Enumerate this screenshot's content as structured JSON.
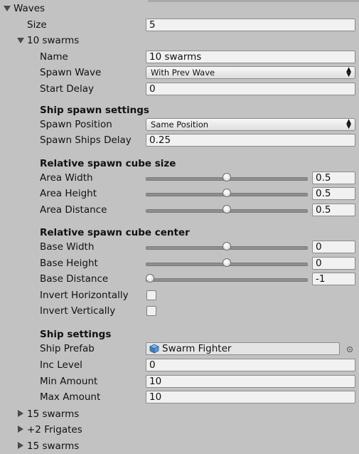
{
  "waves": {
    "label": "Waves",
    "size": {
      "label": "Size",
      "value": "5"
    },
    "element": {
      "label": "10 swarms",
      "name": {
        "label": "Name",
        "value": "10 swarms"
      },
      "spawn_wave": {
        "label": "Spawn Wave",
        "value": "With Prev Wave"
      },
      "start_delay": {
        "label": "Start Delay",
        "value": "0"
      }
    },
    "ship_spawn_settings": {
      "header": "Ship spawn settings",
      "spawn_position": {
        "label": "Spawn Position",
        "value": "Same Position"
      },
      "spawn_ships_delay": {
        "label": "Spawn Ships Delay",
        "value": "0.25"
      }
    },
    "cube_size": {
      "header": "Relative spawn cube size",
      "area_width": {
        "label": "Area Width",
        "value": "0.5",
        "level": 0.5
      },
      "area_height": {
        "label": "Area Height",
        "value": "0.5",
        "level": 0.5
      },
      "area_distance": {
        "label": "Area Distance",
        "value": "0.5",
        "level": 0.5
      }
    },
    "cube_center": {
      "header": "Relative spawn cube center",
      "base_width": {
        "label": "Base Width",
        "value": "0",
        "level": 0.5
      },
      "base_height": {
        "label": "Base Height",
        "value": "0",
        "level": 0.5
      },
      "base_distance": {
        "label": "Base Distance",
        "value": "-1",
        "level": 0.0
      },
      "invert_horizontally": {
        "label": "Invert Horizontally",
        "checked": false
      },
      "invert_vertically": {
        "label": "Invert Vertically",
        "checked": false
      }
    },
    "ship_settings": {
      "header": "Ship settings",
      "ship_prefab": {
        "label": "Ship Prefab",
        "value": "Swarm Fighter",
        "icon": "cube-icon"
      },
      "inc_level": {
        "label": "Inc Level",
        "value": "0"
      },
      "min_amount": {
        "label": "Min Amount",
        "value": "10"
      },
      "max_amount": {
        "label": "Max Amount",
        "value": "10"
      }
    },
    "collapsed_elements": [
      "15 swarms",
      "+2 Frigates",
      "15 swarms"
    ]
  }
}
